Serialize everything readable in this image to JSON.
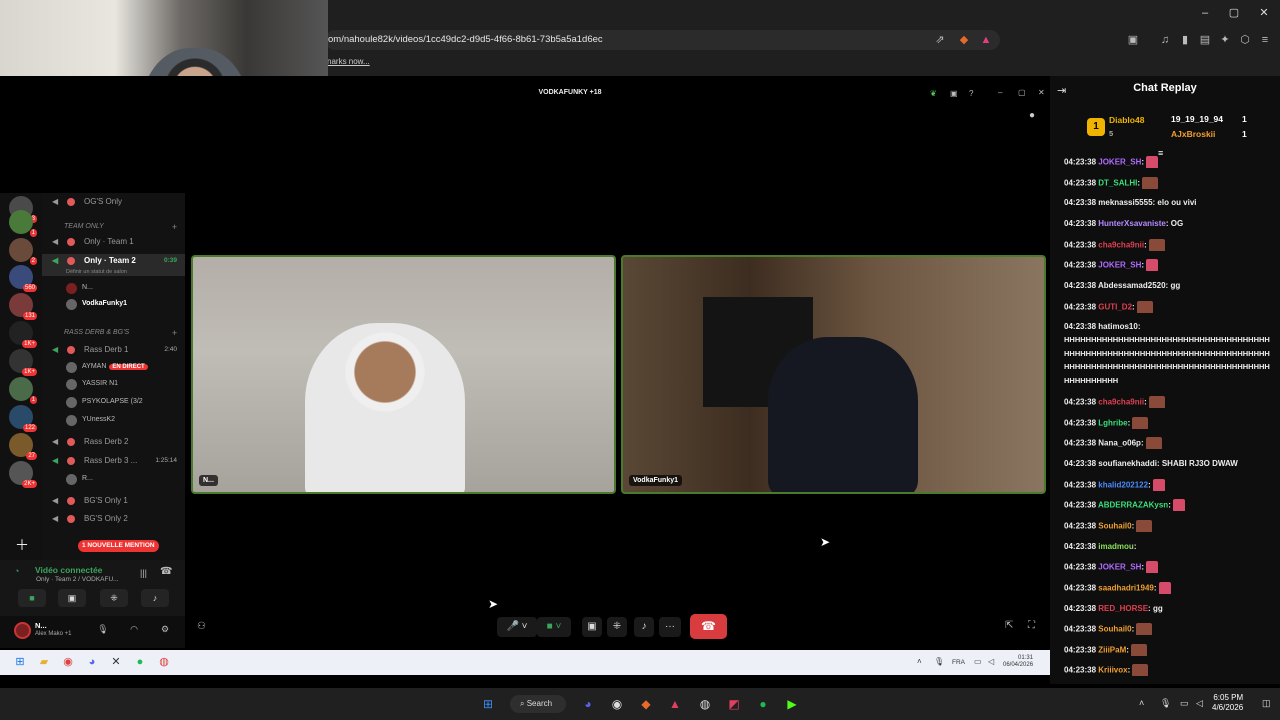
{
  "browser": {
    "url": "om/nahoule82k/videos/1cc49dc2-d9d5-4f66-8b61-73b5a5a1d6ec",
    "bookmarks_text": "narks now..."
  },
  "discord": {
    "window_title": "VODKAFUNKY +18",
    "channels": [
      {
        "label": "OG'S Only",
        "kind": "voice"
      },
      {
        "label": "TEAM ONLY",
        "kind": "category"
      },
      {
        "label": "Only · Team 1",
        "kind": "voice"
      },
      {
        "label": "Only · Team 2",
        "kind": "voice",
        "timer": "0:39",
        "status": "Définir un statut de salon"
      },
      {
        "label": "RASS DERB & BG'S",
        "kind": "category"
      },
      {
        "label": "Rass Derb 1",
        "kind": "voice",
        "timer": "2:40"
      },
      {
        "label": "Rass Derb 2",
        "kind": "voice"
      },
      {
        "label": "Rass Derb 3 ...",
        "kind": "voice",
        "timer": "1:25:14"
      },
      {
        "label": "BG'S Only 1",
        "kind": "voice"
      },
      {
        "label": "BG'S Only 2",
        "kind": "voice"
      }
    ],
    "team2_members": [
      "N...",
      "VodkaFunky1"
    ],
    "derb1_members": [
      "AYMAN",
      "YASSIR N1",
      "PSYKOLAPSE (3/2",
      "YUnessK2"
    ],
    "derb1_live_badge": "EN DIRECT",
    "derb3_members": [
      "R..."
    ],
    "server_badges": [
      "3",
      "1",
      "2",
      "560",
      "131",
      "1K+",
      "1K+",
      "1",
      "122",
      "27",
      "2K+"
    ],
    "new_mention": "1 NOUVELLE MENTION",
    "voice": {
      "status": "Vidéo connectée",
      "channel": "Only · Team 2 / VODKAFU..."
    },
    "user": {
      "name": "N...",
      "status": "Alex Mako +1"
    },
    "tiles": [
      {
        "name": "N..."
      },
      {
        "name": "VodkaFunky1"
      }
    ]
  },
  "inner_taskbar": {
    "lang": "FRA",
    "time": "01:31",
    "date": "06/04/2026"
  },
  "chat": {
    "title": "Chat Replay",
    "leaderboard": [
      {
        "rank": "1",
        "name": "Diablo48",
        "count": "5",
        "color": "#f0b400"
      },
      {
        "name": "19_19_19_94",
        "count": "1",
        "color": "#ffffff"
      },
      {
        "name": "AJxBroskii",
        "count": "1",
        "color": "#f0a030"
      }
    ],
    "messages": [
      {
        "time": "04:23:38",
        "user": "JOKER_SH",
        "color": "#b06aff",
        "text": "",
        "emote": "hand"
      },
      {
        "time": "04:23:38",
        "user": "DT_SALHI",
        "color": "#3adf7a",
        "text": "",
        "emote": "face"
      },
      {
        "time": "04:23:38",
        "user": "meknassi5555",
        "color": "#eeeeee",
        "text": "elo ou vivi",
        "emote": ""
      },
      {
        "time": "04:23:38",
        "user": "HunterXsavaniste",
        "color": "#b88aff",
        "text": "OG",
        "emote": ""
      },
      {
        "time": "04:23:38",
        "user": "cha9cha9nii",
        "color": "#e04050",
        "text": "",
        "emote": "face"
      },
      {
        "time": "04:23:38",
        "user": "JOKER_SH",
        "color": "#b06aff",
        "text": "",
        "emote": "hand"
      },
      {
        "time": "04:23:38",
        "user": "Abdessamad2520",
        "color": "#eeeeee",
        "text": "gg",
        "emote": ""
      },
      {
        "time": "04:23:38",
        "user": "GUTI_D2",
        "color": "#e04050",
        "text": "",
        "emote": "face"
      },
      {
        "time": "04:23:38",
        "user": "hatimos10",
        "color": "#eeeeee",
        "text": "HHHHHHHHHHHHHHHHHHHHHHHHHHHHHHHHHHHHHHHHHHHHHHHHHHHHHHHHHHHHHHHHHHHHHHHHHHHHHHHHHHHHHHHHHHHHHHHHHHHHHHHHHHHHHHHHHHHHHHHHHHHH",
        "emote": "",
        "wrap": true
      },
      {
        "time": "04:23:38",
        "user": "cha9cha9nii",
        "color": "#e04050",
        "text": "",
        "emote": "face"
      },
      {
        "time": "04:23:38",
        "user": "Lghribe",
        "color": "#3adf7a",
        "text": "",
        "emote": "face"
      },
      {
        "time": "04:23:38",
        "user": "Nana_o06p",
        "color": "#eeeeee",
        "text": "",
        "emote": "face"
      },
      {
        "time": "04:23:38",
        "user": "soufianekhaddi",
        "color": "#eeeeee",
        "text": "SHABI RJ3O DWAW",
        "emote": ""
      },
      {
        "time": "04:23:38",
        "user": "khalid202122",
        "color": "#4a8aff",
        "text": "",
        "emote": "hand"
      },
      {
        "time": "04:23:38",
        "user": "ABDERRAZAKysn",
        "color": "#3adf7a",
        "text": "",
        "emote": "hand"
      },
      {
        "time": "04:23:38",
        "user": "Souhail0",
        "color": "#f0a030",
        "text": "",
        "emote": "face"
      },
      {
        "time": "04:23:38",
        "user": "imadmou",
        "color": "#8adf5a",
        "text": "",
        "emote": ""
      },
      {
        "time": "04:23:38",
        "user": "JOKER_SH",
        "color": "#b06aff",
        "text": "",
        "emote": "hand"
      },
      {
        "time": "04:23:38",
        "user": "saadhadri1949",
        "color": "#f0a030",
        "text": "",
        "emote": "hand"
      },
      {
        "time": "04:23:38",
        "user": "RED_HORSE",
        "color": "#e04050",
        "text": "gg",
        "emote": ""
      },
      {
        "time": "04:23:38",
        "user": "Souhail0",
        "color": "#f0a030",
        "text": "",
        "emote": "face"
      },
      {
        "time": "04:23:38",
        "user": "ZiiiPaM",
        "color": "#f0a030",
        "text": "",
        "emote": "face"
      },
      {
        "time": "04:23:38",
        "user": "Kriiivox",
        "color": "#f0a030",
        "text": "",
        "emote": "face"
      }
    ]
  },
  "os_taskbar": {
    "search": "Search",
    "time": "6:05 PM",
    "date": "4/6/2026"
  }
}
